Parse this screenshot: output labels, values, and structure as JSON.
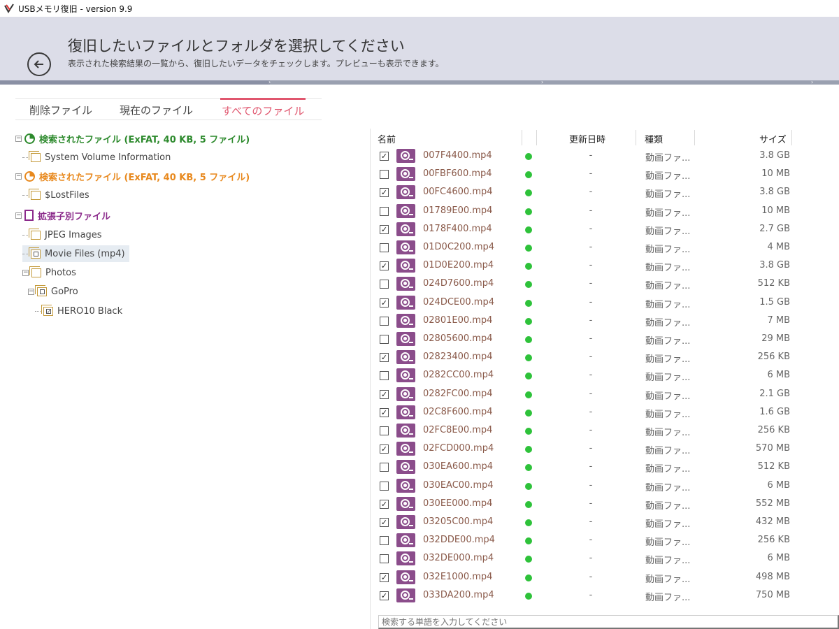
{
  "titlebar": {
    "title": "USBメモリ復旧 - version 9.9"
  },
  "header": {
    "title": "復旧したいファイルとフォルダを選択してください",
    "subtitle": "表示された検索結果の一覧から、復旧したいデータをチェックします。プレビューも表示できます。"
  },
  "tabs": [
    {
      "label": "削除ファイル"
    },
    {
      "label": "現在のファイル"
    },
    {
      "label": "すべてのファイル",
      "active": true
    }
  ],
  "tree": {
    "items": [
      {
        "label": "検索されたファイル (ExFAT, 40 KB, 5 ファイル)"
      },
      {
        "label": "System Volume Information"
      },
      {
        "label": "検索されたファイル (ExFAT, 40 KB, 5 ファイル)"
      },
      {
        "label": "$LostFiles"
      },
      {
        "label": "拡張子別ファイル"
      },
      {
        "label": "JPEG Images"
      },
      {
        "label": "Movie Files (mp4)"
      },
      {
        "label": "Photos"
      },
      {
        "label": "GoPro"
      },
      {
        "label": "HERO10 Black"
      }
    ]
  },
  "table": {
    "columns": {
      "name": "名前",
      "date": "更新日時",
      "type": "種類",
      "size": "サイズ"
    },
    "rows": [
      {
        "checked": true,
        "name": "007F4400.mp4",
        "date": "-",
        "type": "動画ファ...",
        "size": "3.8 GB"
      },
      {
        "checked": false,
        "name": "00FBF600.mp4",
        "date": "-",
        "type": "動画ファ...",
        "size": "10 MB"
      },
      {
        "checked": true,
        "name": "00FC4600.mp4",
        "date": "-",
        "type": "動画ファ...",
        "size": "3.8 GB"
      },
      {
        "checked": false,
        "name": "01789E00.mp4",
        "date": "-",
        "type": "動画ファ...",
        "size": "10 MB"
      },
      {
        "checked": true,
        "name": "0178F400.mp4",
        "date": "-",
        "type": "動画ファ...",
        "size": "2.7 GB"
      },
      {
        "checked": false,
        "name": "01D0C200.mp4",
        "date": "-",
        "type": "動画ファ...",
        "size": "4 MB"
      },
      {
        "checked": true,
        "name": "01D0E200.mp4",
        "date": "-",
        "type": "動画ファ...",
        "size": "3.8 GB"
      },
      {
        "checked": false,
        "name": "024D7600.mp4",
        "date": "-",
        "type": "動画ファ...",
        "size": "512 KB"
      },
      {
        "checked": true,
        "name": "024DCE00.mp4",
        "date": "-",
        "type": "動画ファ...",
        "size": "1.5 GB"
      },
      {
        "checked": false,
        "name": "02801E00.mp4",
        "date": "-",
        "type": "動画ファ...",
        "size": "7 MB"
      },
      {
        "checked": false,
        "name": "02805600.mp4",
        "date": "-",
        "type": "動画ファ...",
        "size": "29 MB"
      },
      {
        "checked": true,
        "name": "02823400.mp4",
        "date": "-",
        "type": "動画ファ...",
        "size": "256 KB"
      },
      {
        "checked": false,
        "name": "0282CC00.mp4",
        "date": "-",
        "type": "動画ファ...",
        "size": "6 MB"
      },
      {
        "checked": true,
        "name": "0282FC00.mp4",
        "date": "-",
        "type": "動画ファ...",
        "size": "2.1 GB"
      },
      {
        "checked": true,
        "name": "02C8F600.mp4",
        "date": "-",
        "type": "動画ファ...",
        "size": "1.6 GB"
      },
      {
        "checked": false,
        "name": "02FC8E00.mp4",
        "date": "-",
        "type": "動画ファ...",
        "size": "256 KB"
      },
      {
        "checked": true,
        "name": "02FCD000.mp4",
        "date": "-",
        "type": "動画ファ...",
        "size": "570 MB"
      },
      {
        "checked": false,
        "name": "030EA600.mp4",
        "date": "-",
        "type": "動画ファ...",
        "size": "512 KB"
      },
      {
        "checked": false,
        "name": "030EAC00.mp4",
        "date": "-",
        "type": "動画ファ...",
        "size": "6 MB"
      },
      {
        "checked": true,
        "name": "030EE000.mp4",
        "date": "-",
        "type": "動画ファ...",
        "size": "552 MB"
      },
      {
        "checked": true,
        "name": "03205C00.mp4",
        "date": "-",
        "type": "動画ファ...",
        "size": "432 MB"
      },
      {
        "checked": false,
        "name": "032DDE00.mp4",
        "date": "-",
        "type": "動画ファ...",
        "size": "256 KB"
      },
      {
        "checked": false,
        "name": "032DE000.mp4",
        "date": "-",
        "type": "動画ファ...",
        "size": "6 MB"
      },
      {
        "checked": true,
        "name": "032E1000.mp4",
        "date": "-",
        "type": "動画ファ...",
        "size": "498 MB"
      },
      {
        "checked": true,
        "name": "033DA200.mp4",
        "date": "-",
        "type": "動画ファ...",
        "size": "750 MB"
      }
    ]
  },
  "search": {
    "placeholder": "検索する単語を入力してください"
  },
  "colors": {
    "accent": "#e0566e",
    "header_bg": "#dcdde8",
    "found_green": "#2d8a2d",
    "found_orange": "#e8891e",
    "ext_purple": "#8b2a8b",
    "status_dot": "#2ec23a",
    "file_icon": "#8b4d8b"
  }
}
